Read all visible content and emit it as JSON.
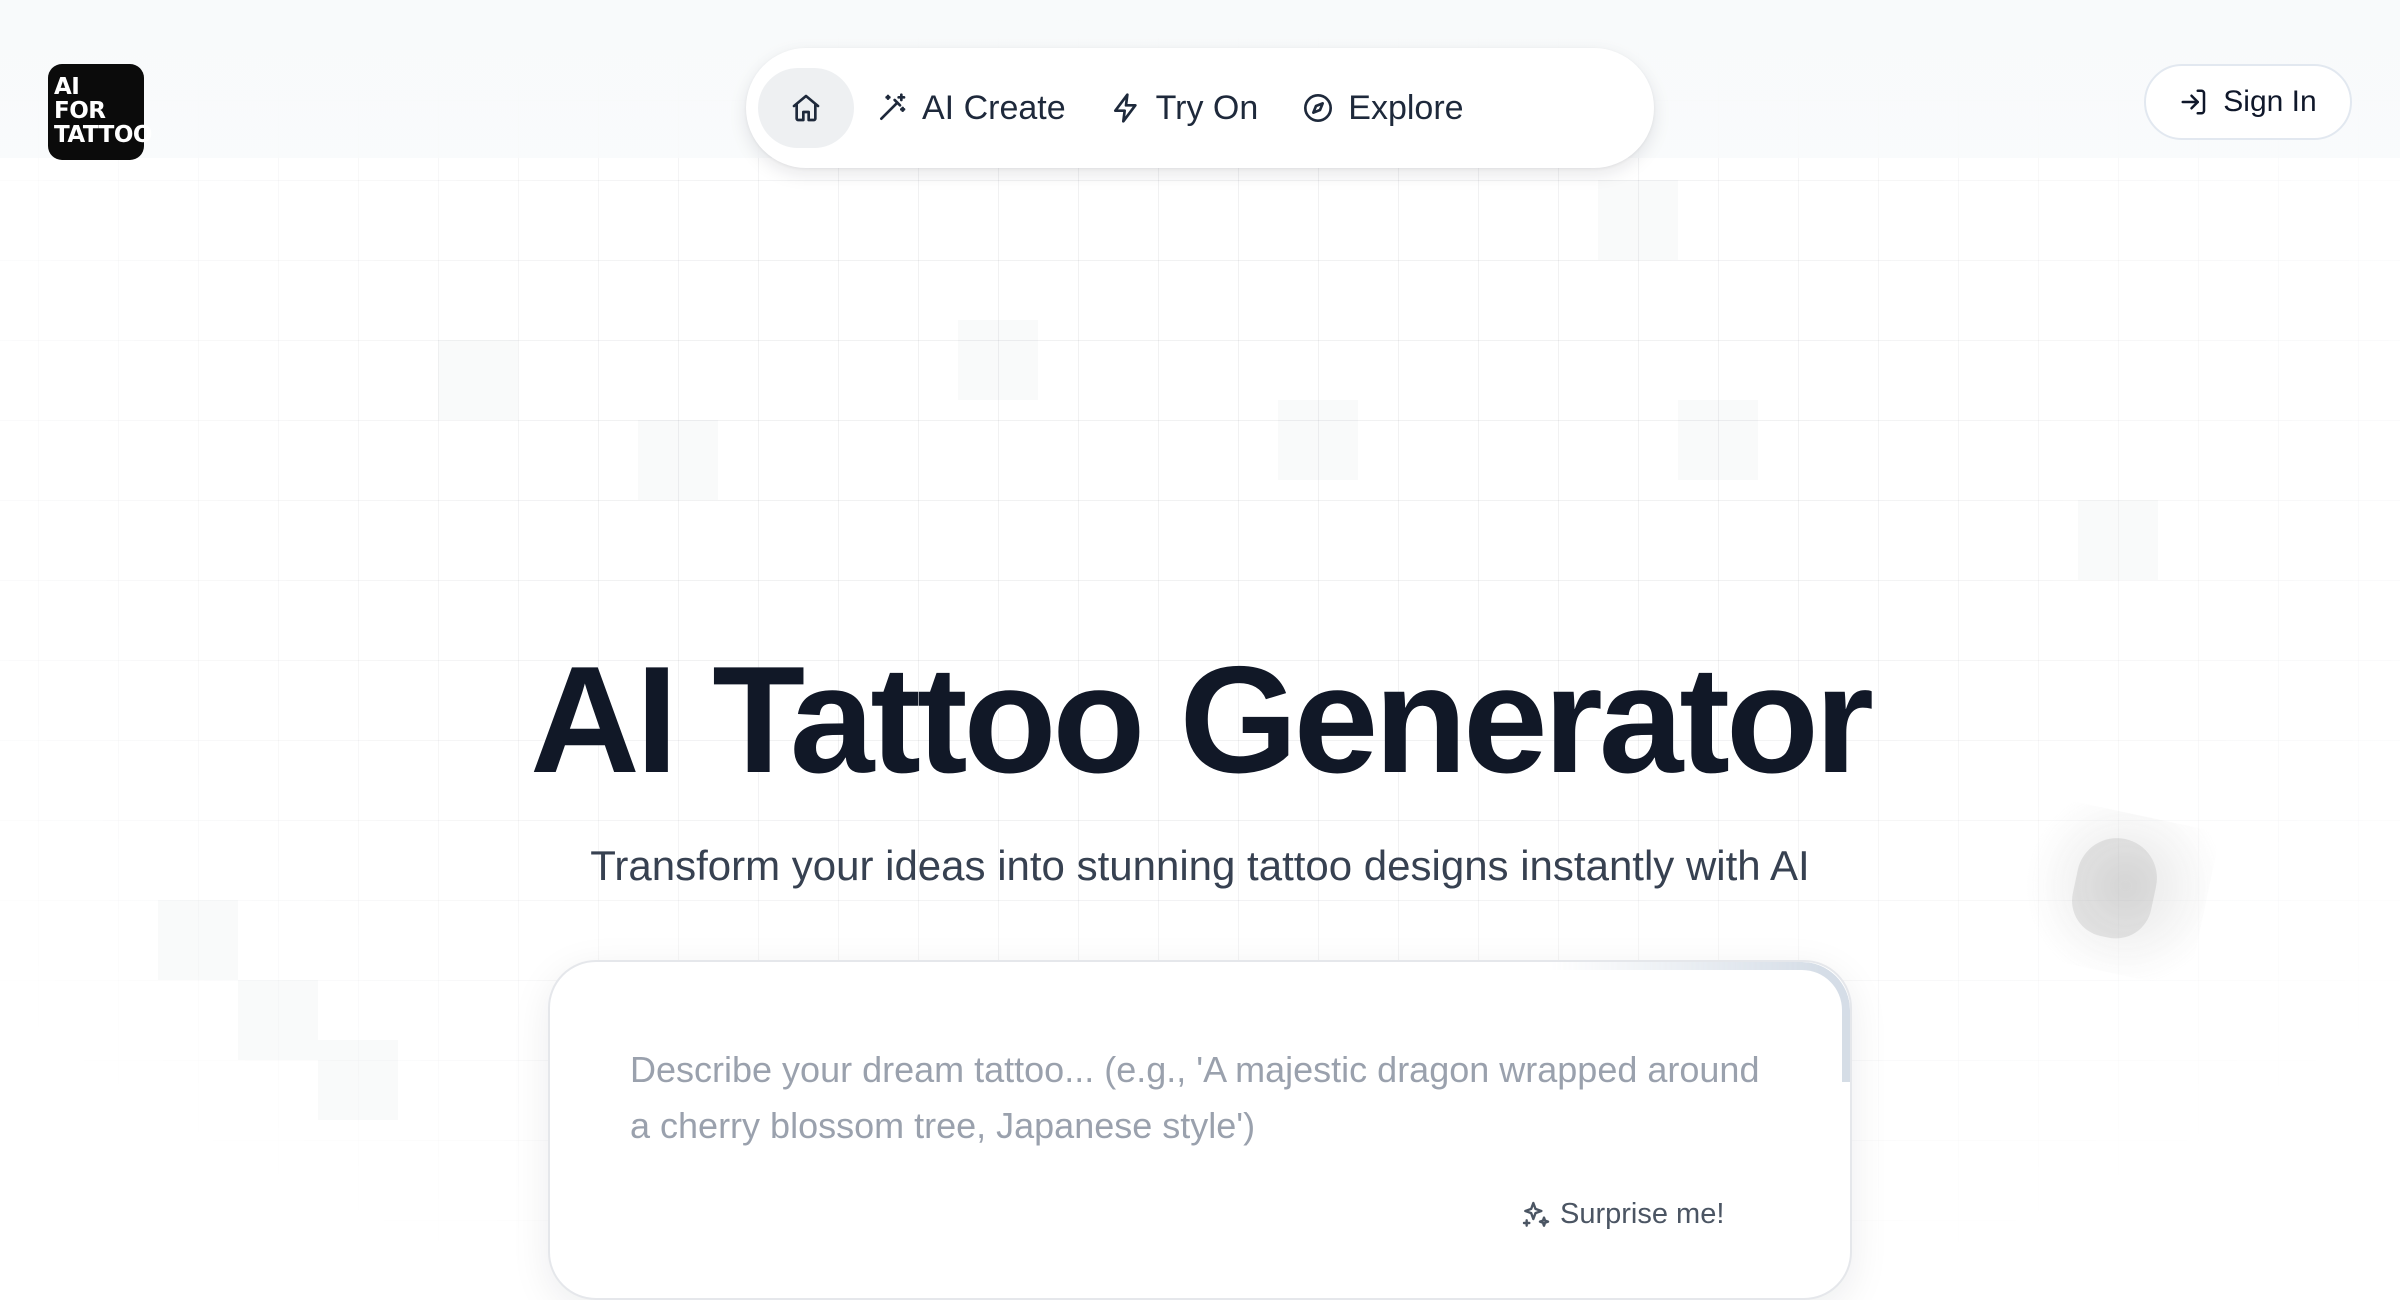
{
  "logo": {
    "lines": [
      "AI",
      "FOR",
      "TATTOO"
    ]
  },
  "nav": {
    "home_icon": "home-icon",
    "items": [
      {
        "label": "AI Create",
        "icon": "magic-wand-icon"
      },
      {
        "label": "Try On",
        "icon": "lightning-icon"
      },
      {
        "label": "Explore",
        "icon": "compass-icon"
      }
    ]
  },
  "header": {
    "signin_label": "Sign In",
    "signin_icon": "log-in-icon"
  },
  "hero": {
    "title": "AI Tattoo Generator",
    "subtitle": "Transform your ideas into stunning tattoo designs instantly with AI"
  },
  "prompt": {
    "placeholder": "Describe your dream tattoo... (e.g., 'A majestic dragon wrapped around a cherry blossom tree, Japanese style')",
    "value": "",
    "surprise_label": "Surprise me!",
    "surprise_icon": "sparkles-icon"
  },
  "colors": {
    "text_primary": "#111827",
    "text_secondary": "#374151",
    "placeholder": "#9aa1ad",
    "logo_bg": "#0b0b0b",
    "nav_active_bg": "#eef0f2"
  }
}
